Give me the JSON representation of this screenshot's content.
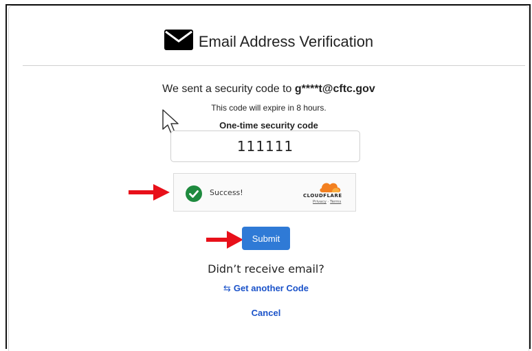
{
  "header": {
    "title": "Email Address Verification",
    "icon": "envelope-icon"
  },
  "message": {
    "sent_prefix": "We sent a security code to",
    "email": "g****t@cftc.gov",
    "expire": "This code will expire in 8 hours."
  },
  "code_field": {
    "label": "One-time security code",
    "value": "111111"
  },
  "captcha": {
    "status": "Success!",
    "brand": "CLOUDFLARE",
    "privacy": "Privacy",
    "separator": "·",
    "terms": "Terms",
    "status_color": "#1e8a3e",
    "brand_color": "#f38020"
  },
  "submit_label": "Submit",
  "resend": {
    "question": "Didn’t receive email?",
    "link": "Get another Code",
    "icon": "repeat-icon"
  },
  "cancel_label": "Cancel",
  "colors": {
    "accent": "#2f7ad6",
    "link": "#1a52c9",
    "annotation_arrow": "#e8101a"
  }
}
